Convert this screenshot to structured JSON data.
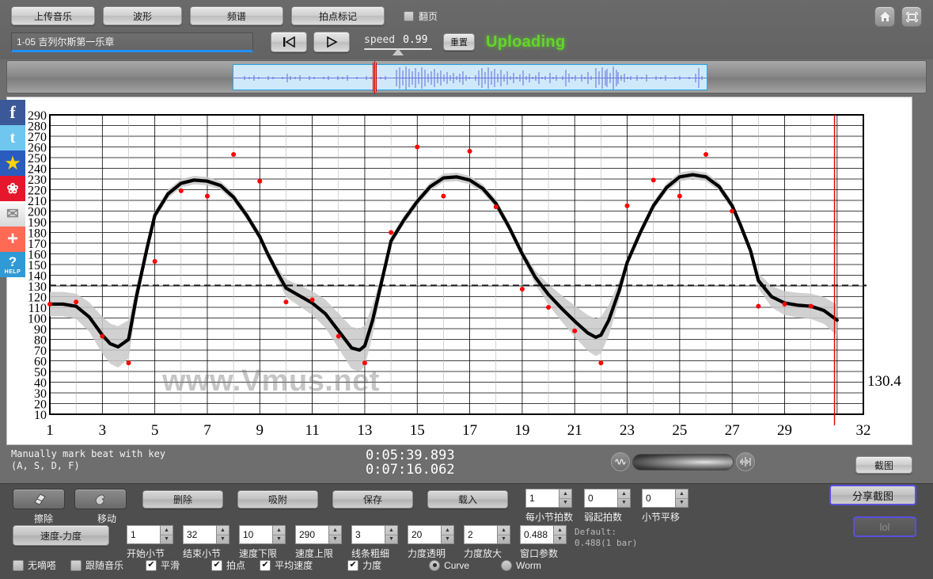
{
  "toolbar": {
    "upload_label": "上传音乐",
    "waveform_label": "波形",
    "spectrum_label": "频谱",
    "beatmark_label": "拍点标记",
    "pageflip_label": "翻页",
    "home_icon": "home-icon",
    "fullscreen_icon": "fullscreen-icon"
  },
  "player": {
    "track_title": "1-05 吉列尔斯第一乐章",
    "rewind_icon": "rewind-to-start-icon",
    "play_icon": "play-icon",
    "speed_label": "speed",
    "speed_value": "0.99",
    "reset_label": "重置",
    "status": "Uploading"
  },
  "social": [
    {
      "name": "facebook",
      "glyph": "f"
    },
    {
      "name": "twitter",
      "glyph": "t"
    },
    {
      "name": "qzone",
      "glyph": "★"
    },
    {
      "name": "weibo",
      "glyph": "❀"
    },
    {
      "name": "email",
      "glyph": "✉"
    },
    {
      "name": "add-more",
      "glyph": "+"
    },
    {
      "name": "help",
      "glyph": "?",
      "sub": "HELP"
    }
  ],
  "chart_data": {
    "type": "line",
    "title": "",
    "xlabel": "",
    "ylabel": "",
    "xlim": [
      1,
      32
    ],
    "ylim": [
      10,
      290
    ],
    "ytick_step": 10,
    "yticks": [
      10,
      20,
      30,
      40,
      50,
      60,
      70,
      80,
      90,
      100,
      110,
      120,
      130,
      140,
      150,
      160,
      170,
      180,
      190,
      200,
      210,
      220,
      230,
      240,
      250,
      260,
      270,
      280,
      290
    ],
    "xticks": [
      1,
      3,
      5,
      7,
      9,
      11,
      13,
      15,
      17,
      19,
      21,
      23,
      25,
      27,
      29,
      32
    ],
    "grid": true,
    "legend": null,
    "watermark": "www.Vmus.net",
    "threshold_line": {
      "value": 130.4,
      "label": "130.4",
      "style": "dashed"
    },
    "playhead_x": 30.9,
    "series": [
      {
        "name": "tempo-curve",
        "type": "line",
        "color": "#000000",
        "x": [
          1,
          1.5,
          2,
          2.5,
          3,
          3.3,
          3.6,
          4,
          4.3,
          4.7,
          5,
          5.5,
          6,
          6.5,
          7,
          7.5,
          8,
          8.5,
          9,
          9.3,
          9.7,
          10,
          10.5,
          11,
          11.5,
          12,
          12.5,
          12.8,
          13,
          13.3,
          13.7,
          14,
          14.5,
          15,
          15.5,
          16,
          16.5,
          17,
          17.5,
          18,
          18.5,
          19,
          19.5,
          20,
          20.5,
          21,
          21.5,
          21.8,
          22,
          22.3,
          22.7,
          23,
          23.5,
          24,
          24.5,
          25,
          25.5,
          26,
          26.5,
          27,
          27.3,
          27.7,
          28,
          28.5,
          29,
          29.5,
          30,
          30.5,
          31
        ],
        "y": [
          113,
          113,
          111,
          101,
          84,
          76,
          73,
          80,
          120,
          165,
          196,
          216,
          226,
          229,
          228,
          224,
          213,
          196,
          176,
          160,
          141,
          128,
          121,
          114,
          104,
          88,
          72,
          70,
          74,
          98,
          140,
          172,
          192,
          209,
          223,
          231,
          232,
          229,
          221,
          207,
          185,
          160,
          138,
          122,
          109,
          97,
          86,
          82,
          84,
          98,
          126,
          152,
          180,
          205,
          222,
          232,
          234,
          232,
          223,
          205,
          188,
          163,
          135,
          120,
          114,
          112,
          111,
          107,
          98
        ]
      },
      {
        "name": "dynamics-band",
        "type": "band",
        "color": "#cccccc",
        "description": "grey confidence/dynamics ribbon around the tempo curve"
      },
      {
        "name": "beat-points",
        "type": "scatter",
        "color": "#ff0000",
        "points": [
          [
            1,
            113
          ],
          [
            2,
            115
          ],
          [
            3,
            83
          ],
          [
            4,
            58
          ],
          [
            5,
            153
          ],
          [
            6,
            219
          ],
          [
            7,
            214
          ],
          [
            8,
            253
          ],
          [
            9,
            228
          ],
          [
            10,
            115
          ],
          [
            11,
            117
          ],
          [
            12,
            83
          ],
          [
            13,
            58
          ],
          [
            14,
            180
          ],
          [
            15,
            260
          ],
          [
            16,
            214
          ],
          [
            17,
            256
          ],
          [
            18,
            204
          ],
          [
            19,
            127
          ],
          [
            20,
            110
          ],
          [
            21,
            88
          ],
          [
            22,
            58
          ],
          [
            23,
            205
          ],
          [
            24,
            229
          ],
          [
            25,
            214
          ],
          [
            26,
            253
          ],
          [
            27,
            200
          ],
          [
            28,
            111
          ],
          [
            29,
            113
          ],
          [
            30,
            111
          ]
        ]
      }
    ]
  },
  "status": {
    "hint_line1": "Manually mark beat with key",
    "hint_line2": "(A, S, D, F)",
    "time_current": "0:05:39.893",
    "time_total": "0:07:16.062",
    "zoom_out_icon": "waveform-zoom-out-icon",
    "zoom_in_icon": "waveform-zoom-in-icon",
    "snapshot_label": "截图"
  },
  "editor": {
    "erase_label": "擦除",
    "erase_icon": "eraser-icon",
    "move_label": "移动",
    "move_icon": "hand-move-icon",
    "delete_label": "删除",
    "snap_label": "吸附",
    "save_label": "保存",
    "load_label": "载入",
    "tempo_dynamics_label": "速度-力度",
    "spinners_row1": [
      {
        "name": "beats-per-bar",
        "value": "1",
        "label": "每小节拍数"
      },
      {
        "name": "pickup-beats",
        "value": "0",
        "label": "弱起拍数"
      },
      {
        "name": "bar-shift",
        "value": "0",
        "label": "小节平移"
      }
    ],
    "spinners_row2": [
      {
        "name": "start-bar",
        "value": "1",
        "label": "开始小节"
      },
      {
        "name": "end-bar",
        "value": "32",
        "label": "结束小节"
      },
      {
        "name": "tempo-min",
        "value": "10",
        "label": "速度下限"
      },
      {
        "name": "tempo-max",
        "value": "290",
        "label": "速度上限"
      },
      {
        "name": "line-width",
        "value": "3",
        "label": "线条粗细"
      },
      {
        "name": "dynamics-opacity",
        "value": "20",
        "label": "力度透明"
      },
      {
        "name": "dynamics-scale",
        "value": "2",
        "label": "力度放大"
      },
      {
        "name": "window-param",
        "value": "0.488",
        "label": "窗口参数"
      }
    ],
    "default_note_line1": "Default:",
    "default_note_line2": "0.488(1 bar)",
    "checkboxes": [
      {
        "name": "no-click",
        "label": "无嘀嗒",
        "checked": false
      },
      {
        "name": "follow-music",
        "label": "跟随音乐",
        "checked": false
      },
      {
        "name": "smooth",
        "label": "平滑",
        "checked": true
      },
      {
        "name": "beats",
        "label": "拍点",
        "checked": true
      },
      {
        "name": "average-tempo",
        "label": "平均速度",
        "checked": true
      },
      {
        "name": "dynamics",
        "label": "力度",
        "checked": true
      }
    ],
    "radios": [
      {
        "name": "curve",
        "label": "Curve",
        "checked": true
      },
      {
        "name": "worm",
        "label": "Worm",
        "checked": false
      }
    ],
    "share_snapshot_label": "分享截图",
    "share_disabled_label": "lol"
  }
}
